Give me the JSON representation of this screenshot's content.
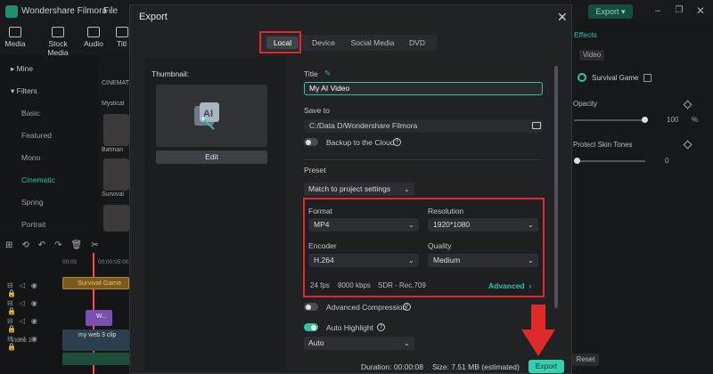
{
  "app": {
    "name": "Wondershare Filmora",
    "file_menu": "File",
    "export_label": "Export",
    "toolbar": [
      "Media",
      "Stock Media",
      "Audio",
      "Titl"
    ]
  },
  "left_panel": {
    "mine": "Mine",
    "filters": "Filters",
    "items": [
      "Basic",
      "Featured",
      "Mono",
      "Cinematic",
      "Spring",
      "Portrait"
    ],
    "thumbs": [
      "CINEMATI",
      "Mystical",
      "Batman",
      "Survival"
    ]
  },
  "timeline": {
    "times": [
      "00:00",
      "00:00:05:00"
    ],
    "clip_survival": "Survival Game",
    "clip_title": "W...",
    "clip_video": "my web 3 clip",
    "video_track": "Video 1"
  },
  "right_panel": {
    "tab": "Effects",
    "chip": "Video",
    "effect_name": "Survival Game",
    "opacity_label": "Opacity",
    "opacity_value": "100",
    "opacity_unit": "%",
    "skin_label": "Protect Skin Tones",
    "skin_value": "0",
    "reset": "Reset"
  },
  "export_dialog": {
    "title": "Export",
    "tabs": [
      "Local",
      "Device",
      "Social Media",
      "DVD"
    ],
    "thumbnail_label": "Thumbnail:",
    "edit_button": "Edit",
    "title_label": "Title",
    "title_value": "My AI Video",
    "save_to_label": "Save to",
    "save_path": "C:/Data D/Wondershare Filmora",
    "backup_label": "Backup to the Cloud",
    "preset_label": "Preset",
    "preset_value": "Match to project settings",
    "format_label": "Format",
    "format_value": "MP4",
    "resolution_label": "Resolution",
    "resolution_value": "1920*1080",
    "encoder_label": "Encoder",
    "encoder_value": "H.264",
    "quality_label": "Quality",
    "quality_value": "Medium",
    "fps": "24 fps",
    "bitrate": "8000 kbps",
    "color": "SDR - Rec.709",
    "advanced_label": "Advanced",
    "adv_compression_label": "Advanced Compression",
    "auto_highlight_label": "Auto Highlight",
    "auto_value": "Auto",
    "duration": "Duration: 00:00:08",
    "size": "Size:  7.51 MB (estimated)",
    "export_button": "Export",
    "backup_on": false,
    "adv_compression_on": false,
    "auto_highlight_on": true
  },
  "colors": {
    "accent": "#2ec3a2",
    "annotation_red": "#e02a2a",
    "export_button": "#2dd3b0"
  }
}
